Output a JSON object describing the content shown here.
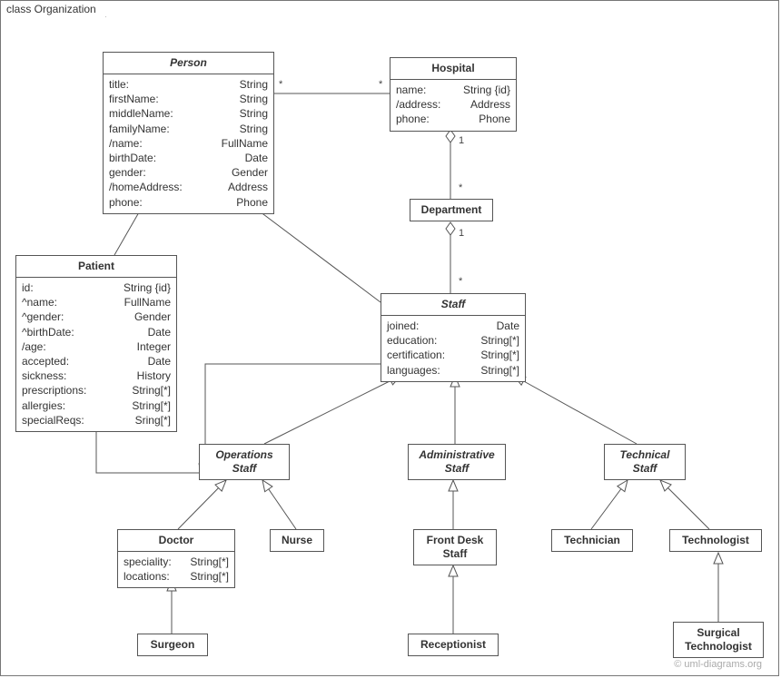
{
  "frame": {
    "label": "class Organization"
  },
  "watermark": "© uml-diagrams.org",
  "classes": {
    "person": {
      "title": "Person",
      "attrs": [
        {
          "k": "title:",
          "v": "String"
        },
        {
          "k": "firstName:",
          "v": "String"
        },
        {
          "k": "middleName:",
          "v": "String"
        },
        {
          "k": "familyName:",
          "v": "String"
        },
        {
          "k": "/name:",
          "v": "FullName"
        },
        {
          "k": "birthDate:",
          "v": "Date"
        },
        {
          "k": "gender:",
          "v": "Gender"
        },
        {
          "k": "/homeAddress:",
          "v": "Address"
        },
        {
          "k": "phone:",
          "v": "Phone"
        }
      ]
    },
    "hospital": {
      "title": "Hospital",
      "attrs": [
        {
          "k": "name:",
          "v": "String {id}"
        },
        {
          "k": "/address:",
          "v": "Address"
        },
        {
          "k": "phone:",
          "v": "Phone"
        }
      ]
    },
    "department": {
      "title": "Department"
    },
    "patient": {
      "title": "Patient",
      "attrs": [
        {
          "k": "id:",
          "v": "String {id}"
        },
        {
          "k": "^name:",
          "v": "FullName"
        },
        {
          "k": "^gender:",
          "v": "Gender"
        },
        {
          "k": "^birthDate:",
          "v": "Date"
        },
        {
          "k": "/age:",
          "v": "Integer"
        },
        {
          "k": "accepted:",
          "v": "Date"
        },
        {
          "k": "sickness:",
          "v": "History"
        },
        {
          "k": "prescriptions:",
          "v": "String[*]"
        },
        {
          "k": "allergies:",
          "v": "String[*]"
        },
        {
          "k": "specialReqs:",
          "v": "Sring[*]"
        }
      ]
    },
    "staff": {
      "title": "Staff",
      "attrs": [
        {
          "k": "joined:",
          "v": "Date"
        },
        {
          "k": "education:",
          "v": "String[*]"
        },
        {
          "k": "certification:",
          "v": "String[*]"
        },
        {
          "k": "languages:",
          "v": "String[*]"
        }
      ]
    },
    "opsStaff": {
      "title": "Operations\nStaff"
    },
    "adminStaff": {
      "title": "Administrative\nStaff"
    },
    "techStaff": {
      "title": "Technical\nStaff"
    },
    "doctor": {
      "title": "Doctor",
      "attrs": [
        {
          "k": "speciality:",
          "v": "String[*]"
        },
        {
          "k": "locations:",
          "v": "String[*]"
        }
      ]
    },
    "nurse": {
      "title": "Nurse"
    },
    "frontDesk": {
      "title": "Front Desk\nStaff"
    },
    "technician": {
      "title": "Technician"
    },
    "technologist": {
      "title": "Technologist"
    },
    "surgeon": {
      "title": "Surgeon"
    },
    "receptionist": {
      "title": "Receptionist"
    },
    "surgTech": {
      "title": "Surgical\nTechnologist"
    }
  },
  "multiplicities": {
    "personHospL": "*",
    "personHospR": "*",
    "hospDeptTop": "1",
    "hospDeptBot": "*",
    "deptStaffTop": "1",
    "deptStaffBot": "*",
    "patientStaffL": "*",
    "patientStaffR": "*"
  }
}
